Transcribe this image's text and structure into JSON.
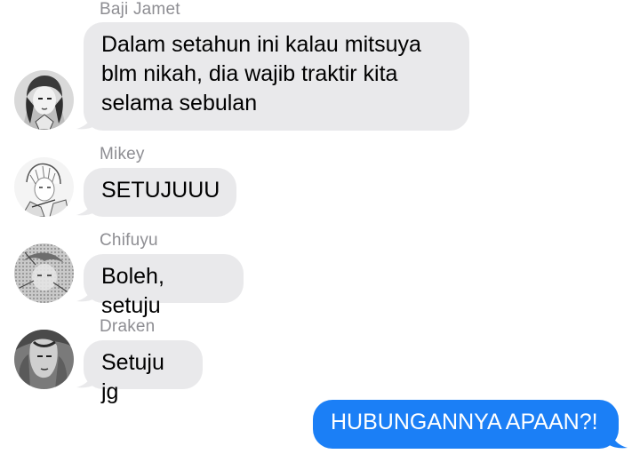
{
  "conversation": {
    "messages": [
      {
        "sender": "Baji Jamet",
        "text": "Dalam setahun ini kalau mitsuya blm nikah, dia wajib traktir kita selama sebulan",
        "direction": "incoming",
        "avatar_icon": "manga-portrait-icon"
      },
      {
        "sender": "Mikey",
        "text": "SETUJUUU",
        "direction": "incoming",
        "avatar_icon": "manga-portrait-icon"
      },
      {
        "sender": "Chifuyu",
        "text": "Boleh, setuju",
        "direction": "incoming",
        "avatar_icon": "manga-portrait-icon"
      },
      {
        "sender": "Draken",
        "text": "Setuju jg",
        "direction": "incoming",
        "avatar_icon": "manga-portrait-icon"
      },
      {
        "sender": "",
        "text": "HUBUNGANNYA APAAN?!",
        "direction": "outgoing"
      }
    ]
  },
  "colors": {
    "incoming_bubble": "#e9e9eb",
    "outgoing_bubble": "#1b7ff6",
    "sender_name": "#8e8e93"
  }
}
